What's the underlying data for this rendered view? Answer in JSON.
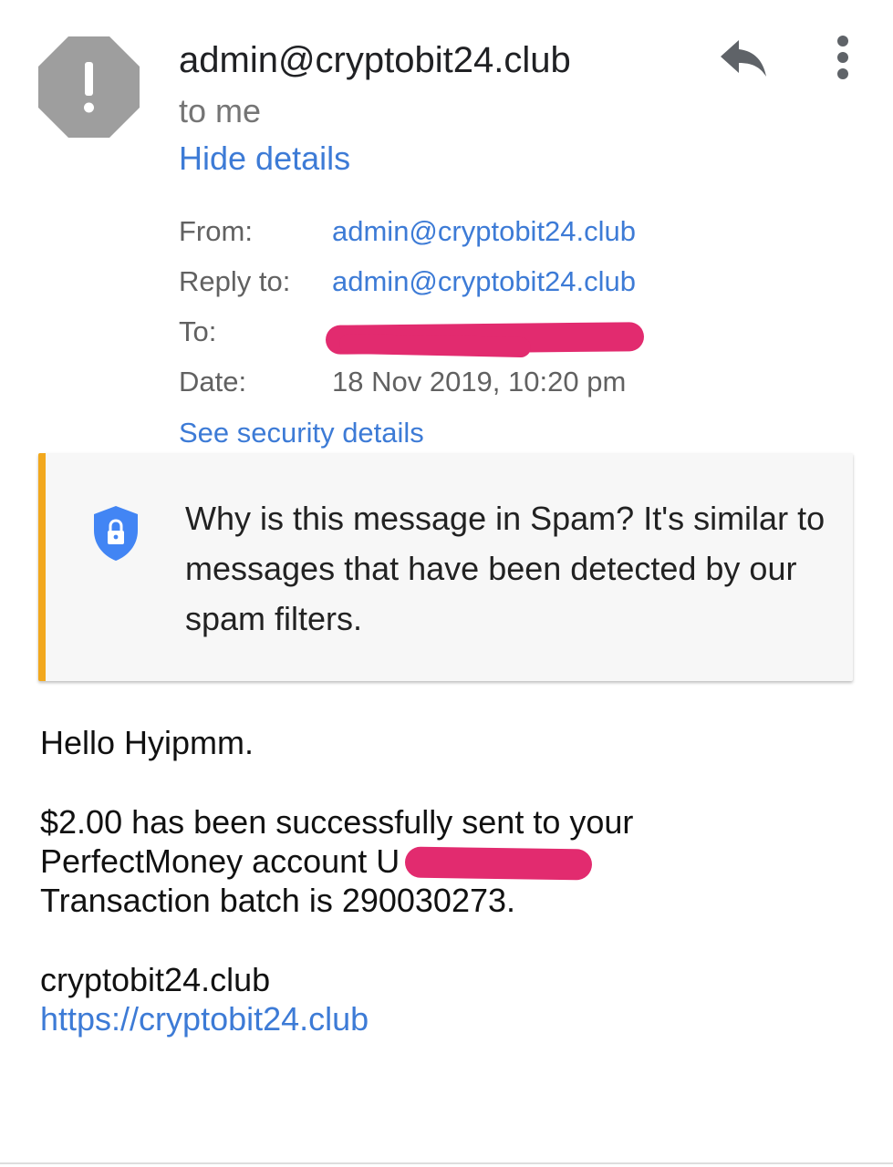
{
  "header": {
    "sender": "admin@cryptobit24.club",
    "recipient_summary": "to me",
    "hide_details_label": "Hide details",
    "avatar_icon": "spam-warning-icon",
    "reply_icon": "reply-icon",
    "more_icon": "more-vert-icon"
  },
  "details": {
    "from_label": "From:",
    "from_value": "admin@cryptobit24.club",
    "reply_to_label": "Reply to:",
    "reply_to_value": "admin@cryptobit24.club",
    "to_label": "To:",
    "date_label": "Date:",
    "date_value": "18 Nov 2019, 10:20 pm",
    "security_link": "See security details"
  },
  "spam_warning": {
    "icon": "shield-lock-icon",
    "text": "Why is this message in Spam? It's similar to messages that have been detected by our spam filters."
  },
  "message": {
    "greeting": "Hello Hyipmm.",
    "line1": "$2.00 has been successfully sent to your",
    "line2": "PerfectMoney account U",
    "line3": "Transaction batch is 290030273.",
    "signature": "cryptobit24.club",
    "link": "https://cryptobit24.club"
  },
  "colors": {
    "link": "#3d7bd6",
    "warning_bar": "#f2a81d",
    "avatar": "#9e9e9e",
    "redaction": "#e22b6f"
  }
}
